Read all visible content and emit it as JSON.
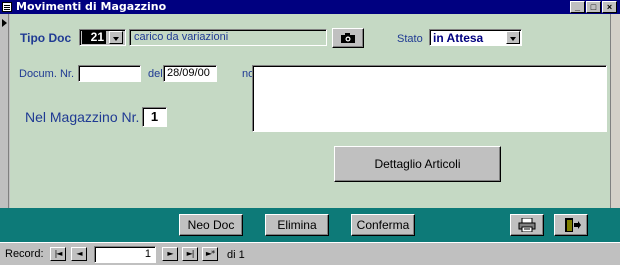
{
  "window": {
    "title": "Movimenti di Magazzino",
    "controls": {
      "minimize": "_",
      "maximize": "□",
      "close": "×"
    }
  },
  "form": {
    "tipo_doc": {
      "label": "Tipo Doc",
      "code": "21",
      "description": "carico da variazioni"
    },
    "stato": {
      "label": "Stato",
      "value": "in Attesa"
    },
    "docum_nr": {
      "label": "Docum. Nr.",
      "value": ""
    },
    "del": {
      "label": "del",
      "value": "28/09/00"
    },
    "note": {
      "label": "note",
      "value": ""
    },
    "magazzino": {
      "label": "Nel Magazzino Nr.",
      "value": "1"
    },
    "dettaglio_label": "Dettaglio Articoli"
  },
  "footer": {
    "neo_doc_label": "Neo Doc",
    "elimina_label": "Elimina",
    "conferma_label": "Conferma",
    "print_icon": "printer-icon",
    "exit_icon": "exit-door-icon"
  },
  "navigation": {
    "record_label": "Record:",
    "current_record": "1",
    "total_label": "di 1"
  },
  "colors": {
    "form_background": "#c5d9c4",
    "footer_band": "#0d7a78",
    "label_text": "#1f3a93",
    "title_bar": "#000080"
  }
}
